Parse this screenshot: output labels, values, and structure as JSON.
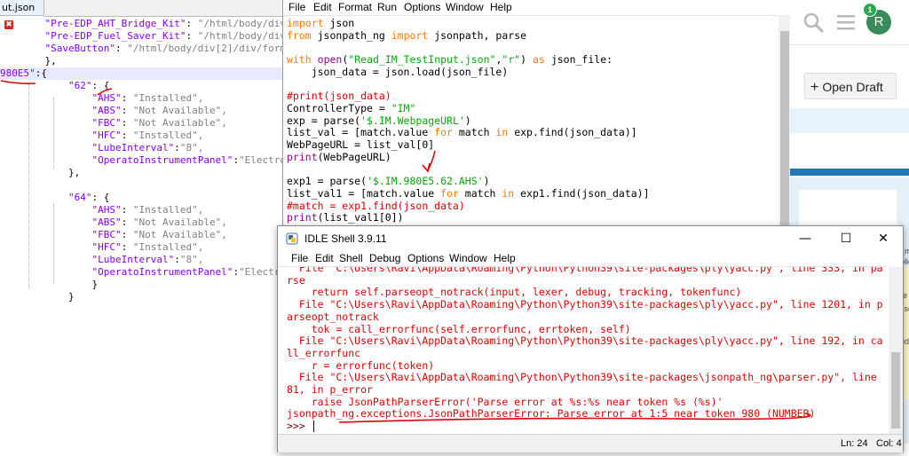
{
  "json_editor": {
    "tab_label": "ut.json",
    "tab_close_glyph": "✖",
    "lines": [
      {
        "ind": "    ",
        "key": "\"Pre-EDP_AHT_Bridge_Kit\"",
        "sep": ": ",
        "val": "\"/html/body/div[2/"
      },
      {
        "ind": "    ",
        "key": "\"Pre-EDP_Fuel_Saver_Kit\"",
        "sep": ": ",
        "val": "\"/html/body/div[2]"
      },
      {
        "ind": "    ",
        "key": "\"SaveButton\"",
        "sep": ": ",
        "val": "\"/html/body/div[2]/div/form/h"
      },
      {
        "ind": "    ",
        "key": "",
        "sep": "},",
        "val": ""
      },
      {
        "ind": "",
        "key": "980E5\"",
        "sep": ":{",
        "val": ""
      },
      {
        "ind": "        ",
        "key": "\"62\"",
        "sep": ": {",
        "val": ""
      },
      {
        "ind": "            ",
        "key": "\"AHS\"",
        "sep": ": ",
        "val": "\"Installed\","
      },
      {
        "ind": "            ",
        "key": "\"ABS\"",
        "sep": ": ",
        "val": "\"Not Available\","
      },
      {
        "ind": "            ",
        "key": "\"FBC\"",
        "sep": ": ",
        "val": "\"Not Available\","
      },
      {
        "ind": "            ",
        "key": "\"HFC\"",
        "sep": ": ",
        "val": "\"Installed\","
      },
      {
        "ind": "            ",
        "key": "\"LubeInterval\"",
        "sep": ":",
        "val": "\"8\","
      },
      {
        "ind": "            ",
        "key": "\"OperatoInstrumentPanel\"",
        "sep": ":",
        "val": "\"Electroni"
      },
      {
        "ind": "        ",
        "key": "",
        "sep": "},",
        "val": ""
      },
      {
        "ind": "",
        "key": "",
        "sep": "",
        "val": ""
      },
      {
        "ind": "        ",
        "key": "\"64\"",
        "sep": ": {",
        "val": ""
      },
      {
        "ind": "            ",
        "key": "\"AHS\"",
        "sep": ": ",
        "val": "\"Installed\","
      },
      {
        "ind": "            ",
        "key": "\"ABS\"",
        "sep": ": ",
        "val": "\"Not Available\","
      },
      {
        "ind": "            ",
        "key": "\"FBC\"",
        "sep": ": ",
        "val": "\"Not Available\","
      },
      {
        "ind": "            ",
        "key": "\"HFC\"",
        "sep": ": ",
        "val": "\"Installed\","
      },
      {
        "ind": "            ",
        "key": "\"LubeInterval\"",
        "sep": ":",
        "val": "\"8\","
      },
      {
        "ind": "            ",
        "key": "\"OperatoInstrumentPanel\"",
        "sep": ":",
        "val": "\"Electroni"
      },
      {
        "ind": "            ",
        "key": "",
        "sep": "}",
        "val": ""
      },
      {
        "ind": "        ",
        "key": "",
        "sep": "}",
        "val": ""
      }
    ]
  },
  "editor_window": {
    "menu": [
      "File",
      "Edit",
      "Format",
      "Run",
      "Options",
      "Window",
      "Help"
    ],
    "code_lines": [
      [
        {
          "t": "import",
          "c": "kw"
        },
        {
          "t": " json",
          "c": ""
        }
      ],
      [
        {
          "t": "from",
          "c": "kw"
        },
        {
          "t": " jsonpath_ng ",
          "c": ""
        },
        {
          "t": "import",
          "c": "kw"
        },
        {
          "t": " jsonpath, parse",
          "c": ""
        }
      ],
      [],
      [
        {
          "t": "with",
          "c": "kw"
        },
        {
          "t": " ",
          "c": ""
        },
        {
          "t": "open",
          "c": "bi"
        },
        {
          "t": "(",
          "c": ""
        },
        {
          "t": "\"Read_IM_TestInput.json\"",
          "c": "st"
        },
        {
          "t": ",",
          "c": ""
        },
        {
          "t": "\"r\"",
          "c": "st"
        },
        {
          "t": ") ",
          "c": ""
        },
        {
          "t": "as",
          "c": "kw"
        },
        {
          "t": " json_file:",
          "c": ""
        }
      ],
      [
        {
          "t": "    json_data = json.load(json_file)",
          "c": ""
        }
      ],
      [],
      [
        {
          "t": "#print(json_data)",
          "c": "cm"
        }
      ],
      [
        {
          "t": "ControllerType = ",
          "c": ""
        },
        {
          "t": "\"IM\"",
          "c": "st"
        }
      ],
      [
        {
          "t": "exp = parse(",
          "c": ""
        },
        {
          "t": "'$.IM.WebpageURL'",
          "c": "st"
        },
        {
          "t": ")",
          "c": ""
        }
      ],
      [
        {
          "t": "list_val = [match.value ",
          "c": ""
        },
        {
          "t": "for",
          "c": "kw"
        },
        {
          "t": " match ",
          "c": ""
        },
        {
          "t": "in",
          "c": "kw"
        },
        {
          "t": " exp.find(json_data)]",
          "c": ""
        }
      ],
      [
        {
          "t": "WebPageURL = list_val[0]",
          "c": ""
        }
      ],
      [
        {
          "t": "print",
          "c": "bi"
        },
        {
          "t": "(WebPageURL)",
          "c": ""
        }
      ],
      [],
      [
        {
          "t": "exp1 = parse(",
          "c": ""
        },
        {
          "t": "'$.IM.980E5.62.AHS'",
          "c": "st"
        },
        {
          "t": ")",
          "c": ""
        }
      ],
      [
        {
          "t": "list_val1 = [match.value ",
          "c": ""
        },
        {
          "t": "for",
          "c": "kw"
        },
        {
          "t": " match ",
          "c": ""
        },
        {
          "t": "in",
          "c": "kw"
        },
        {
          "t": " exp1.find(json_data)]",
          "c": ""
        }
      ],
      [
        {
          "t": "#match = exp1.find(json_data)",
          "c": "cm"
        }
      ],
      [
        {
          "t": "print",
          "c": "bi"
        },
        {
          "t": "(list_val1[0])",
          "c": ""
        }
      ]
    ]
  },
  "shell_window": {
    "title": "IDLE Shell 3.9.11",
    "window_controls": {
      "minimize": "—",
      "maximize": "☐",
      "close": "✕"
    },
    "menu": [
      "File",
      "Edit",
      "Shell",
      "Debug",
      "Options",
      "Window",
      "Help"
    ],
    "output_lines": [
      "  File \"C:\\Users\\Ravi\\AppData\\Roaming\\Python\\Python39\\site-packages\\ply\\yacc.py\", line 333, in pa",
      "rse",
      "    return self.parseopt_notrack(input, lexer, debug, tracking, tokenfunc)",
      "  File \"C:\\Users\\Ravi\\AppData\\Roaming\\Python\\Python39\\site-packages\\ply\\yacc.py\", line 1201, in p",
      "arseopt_notrack",
      "    tok = call_errorfunc(self.errorfunc, errtoken, self)",
      "  File \"C:\\Users\\Ravi\\AppData\\Roaming\\Python\\Python39\\site-packages\\ply\\yacc.py\", line 192, in ca",
      "ll_errorfunc",
      "    r = errorfunc(token)",
      "  File \"C:\\Users\\Ravi\\AppData\\Roaming\\Python\\Python39\\site-packages\\jsonpath_ng\\parser.py\", line",
      "81, in p_error",
      "    raise JsonPathParserError('Parse error at %s:%s near token %s (%s)'",
      "jsonpath_ng.exceptions.JsonPathParserError: Parse error at 1:5 near token 980 (NUMBER)"
    ],
    "prompt": ">>> ",
    "status": {
      "line": "Ln: 24",
      "col": "Col: 4"
    }
  },
  "browser": {
    "search_icon": "search-icon",
    "menu_icon": "hamburger-menu-icon",
    "avatar_letter": "R",
    "notification_count": "1",
    "open_draft_label": "Open Draft",
    "edge_fragments": [
      "_m",
      "blic",
      "re",
      "sse",
      "dd",
      "s"
    ]
  },
  "colors": {
    "annotation_red": "#e00000",
    "python_keyword": "#ff7700",
    "python_builtin": "#900090",
    "python_string": "#00aa00",
    "python_comment": "#dd0000",
    "json_key": "#8000ff",
    "avatar_green": "#3a8b5b"
  }
}
